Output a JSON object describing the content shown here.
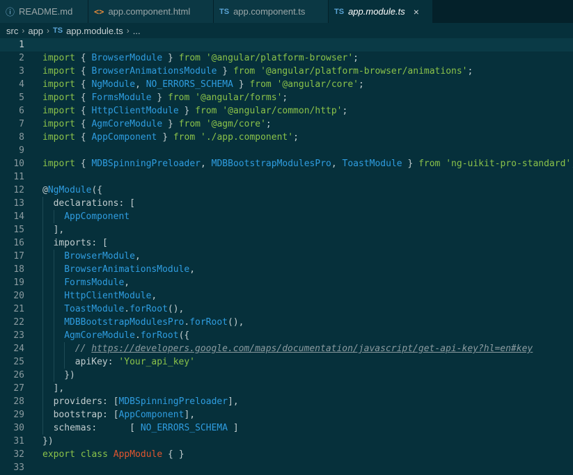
{
  "tabs": [
    {
      "icon": "info-icon",
      "glyph": "ⓘ",
      "label": "README.md"
    },
    {
      "icon": "html-file-icon",
      "glyph": "<>",
      "label": "app.component.html"
    },
    {
      "icon": "ts-file-icon",
      "glyph": "TS",
      "label": "app.component.ts"
    },
    {
      "icon": "ts-file-icon",
      "glyph": "TS",
      "label": "app.module.ts",
      "active": true,
      "close": "×"
    }
  ],
  "breadcrumb": {
    "parts": [
      "src",
      "app"
    ],
    "file_icon_glyph": "TS",
    "file": "app.module.ts",
    "ellipsis": "..."
  },
  "editor": {
    "current_line": 1,
    "lines": [
      {
        "n": "1",
        "indent": 0,
        "tokens": []
      },
      {
        "n": "2",
        "indent": 0,
        "tokens": [
          [
            "kw",
            "import"
          ],
          [
            "pun",
            " { "
          ],
          [
            "cls",
            "BrowserModule"
          ],
          [
            "pun",
            " } "
          ],
          [
            "kw",
            "from"
          ],
          [
            "pun",
            " "
          ],
          [
            "str",
            "'@angular/platform-browser'"
          ],
          [
            "pun",
            ";"
          ]
        ]
      },
      {
        "n": "3",
        "indent": 0,
        "tokens": [
          [
            "kw",
            "import"
          ],
          [
            "pun",
            " { "
          ],
          [
            "cls",
            "BrowserAnimationsModule"
          ],
          [
            "pun",
            " } "
          ],
          [
            "kw",
            "from"
          ],
          [
            "pun",
            " "
          ],
          [
            "str",
            "'@angular/platform-browser/animations'"
          ],
          [
            "pun",
            ";"
          ]
        ]
      },
      {
        "n": "4",
        "indent": 0,
        "tokens": [
          [
            "kw",
            "import"
          ],
          [
            "pun",
            " { "
          ],
          [
            "cls",
            "NgModule"
          ],
          [
            "pun",
            ", "
          ],
          [
            "cls",
            "NO_ERRORS_SCHEMA"
          ],
          [
            "pun",
            " } "
          ],
          [
            "kw",
            "from"
          ],
          [
            "pun",
            " "
          ],
          [
            "str",
            "'@angular/core'"
          ],
          [
            "pun",
            ";"
          ]
        ]
      },
      {
        "n": "5",
        "indent": 0,
        "tokens": [
          [
            "kw",
            "import"
          ],
          [
            "pun",
            " { "
          ],
          [
            "cls",
            "FormsModule"
          ],
          [
            "pun",
            " } "
          ],
          [
            "kw",
            "from"
          ],
          [
            "pun",
            " "
          ],
          [
            "str",
            "'@angular/forms'"
          ],
          [
            "pun",
            ";"
          ]
        ]
      },
      {
        "n": "6",
        "indent": 0,
        "tokens": [
          [
            "kw",
            "import"
          ],
          [
            "pun",
            " { "
          ],
          [
            "cls",
            "HttpClientModule"
          ],
          [
            "pun",
            " } "
          ],
          [
            "kw",
            "from"
          ],
          [
            "pun",
            " "
          ],
          [
            "str",
            "'@angular/common/http'"
          ],
          [
            "pun",
            ";"
          ]
        ]
      },
      {
        "n": "7",
        "indent": 0,
        "tokens": [
          [
            "kw",
            "import"
          ],
          [
            "pun",
            " { "
          ],
          [
            "cls",
            "AgmCoreModule"
          ],
          [
            "pun",
            " } "
          ],
          [
            "kw",
            "from"
          ],
          [
            "pun",
            " "
          ],
          [
            "str",
            "'@agm/core'"
          ],
          [
            "pun",
            ";"
          ]
        ]
      },
      {
        "n": "8",
        "indent": 0,
        "tokens": [
          [
            "kw",
            "import"
          ],
          [
            "pun",
            " { "
          ],
          [
            "cls",
            "AppComponent"
          ],
          [
            "pun",
            " } "
          ],
          [
            "kw",
            "from"
          ],
          [
            "pun",
            " "
          ],
          [
            "str",
            "'./app.component'"
          ],
          [
            "pun",
            ";"
          ]
        ]
      },
      {
        "n": "9",
        "indent": 0,
        "tokens": []
      },
      {
        "n": "10",
        "indent": 0,
        "tokens": [
          [
            "kw",
            "import"
          ],
          [
            "pun",
            " { "
          ],
          [
            "cls",
            "MDBSpinningPreloader"
          ],
          [
            "pun",
            ", "
          ],
          [
            "cls",
            "MDBBootstrapModulesPro"
          ],
          [
            "pun",
            ", "
          ],
          [
            "cls",
            "ToastModule"
          ],
          [
            "pun",
            " } "
          ],
          [
            "kw",
            "from"
          ],
          [
            "pun",
            " "
          ],
          [
            "str",
            "'ng-uikit-pro-standard'"
          ],
          [
            "pun",
            ";"
          ]
        ]
      },
      {
        "n": "11",
        "indent": 0,
        "tokens": []
      },
      {
        "n": "12",
        "indent": 0,
        "tokens": [
          [
            "at",
            "@"
          ],
          [
            "dec",
            "NgModule"
          ],
          [
            "pun",
            "({"
          ]
        ]
      },
      {
        "n": "13",
        "indent": 1,
        "tokens": [
          [
            "prop",
            "declarations"
          ],
          [
            "pun",
            ": ["
          ]
        ]
      },
      {
        "n": "14",
        "indent": 2,
        "tokens": [
          [
            "cls",
            "AppComponent"
          ]
        ]
      },
      {
        "n": "15",
        "indent": 1,
        "tokens": [
          [
            "pun",
            "],"
          ]
        ]
      },
      {
        "n": "16",
        "indent": 1,
        "tokens": [
          [
            "prop",
            "imports"
          ],
          [
            "pun",
            ": ["
          ]
        ]
      },
      {
        "n": "17",
        "indent": 2,
        "tokens": [
          [
            "cls",
            "BrowserModule"
          ],
          [
            "pun",
            ","
          ]
        ]
      },
      {
        "n": "18",
        "indent": 2,
        "tokens": [
          [
            "cls",
            "BrowserAnimationsModule"
          ],
          [
            "pun",
            ","
          ]
        ]
      },
      {
        "n": "19",
        "indent": 2,
        "tokens": [
          [
            "cls",
            "FormsModule"
          ],
          [
            "pun",
            ","
          ]
        ]
      },
      {
        "n": "20",
        "indent": 2,
        "tokens": [
          [
            "cls",
            "HttpClientModule"
          ],
          [
            "pun",
            ","
          ]
        ]
      },
      {
        "n": "21",
        "indent": 2,
        "tokens": [
          [
            "cls",
            "ToastModule"
          ],
          [
            "pun",
            "."
          ],
          [
            "fn",
            "forRoot"
          ],
          [
            "pun",
            "(),"
          ]
        ]
      },
      {
        "n": "22",
        "indent": 2,
        "tokens": [
          [
            "cls",
            "MDBBootstrapModulesPro"
          ],
          [
            "pun",
            "."
          ],
          [
            "fn",
            "forRoot"
          ],
          [
            "pun",
            "(),"
          ]
        ]
      },
      {
        "n": "23",
        "indent": 2,
        "tokens": [
          [
            "cls",
            "AgmCoreModule"
          ],
          [
            "pun",
            "."
          ],
          [
            "fn",
            "forRoot"
          ],
          [
            "pun",
            "({"
          ]
        ]
      },
      {
        "n": "24",
        "indent": 3,
        "tokens": [
          [
            "cmt",
            "// "
          ],
          [
            "cmt-link",
            "https://developers.google.com/maps/documentation/javascript/get-api-key?hl=en#key"
          ]
        ]
      },
      {
        "n": "25",
        "indent": 3,
        "tokens": [
          [
            "prop",
            "apiKey"
          ],
          [
            "pun",
            ": "
          ],
          [
            "str",
            "'Your_api_key'"
          ]
        ]
      },
      {
        "n": "26",
        "indent": 2,
        "tokens": [
          [
            "pun",
            "})"
          ]
        ]
      },
      {
        "n": "27",
        "indent": 1,
        "tokens": [
          [
            "pun",
            "],"
          ]
        ]
      },
      {
        "n": "28",
        "indent": 1,
        "tokens": [
          [
            "prop",
            "providers"
          ],
          [
            "pun",
            ": ["
          ],
          [
            "cls",
            "MDBSpinningPreloader"
          ],
          [
            "pun",
            "],"
          ]
        ]
      },
      {
        "n": "29",
        "indent": 1,
        "tokens": [
          [
            "prop",
            "bootstrap"
          ],
          [
            "pun",
            ": ["
          ],
          [
            "cls",
            "AppComponent"
          ],
          [
            "pun",
            "],"
          ]
        ]
      },
      {
        "n": "30",
        "indent": 1,
        "tokens": [
          [
            "prop",
            "schemas"
          ],
          [
            "pun",
            ":      [ "
          ],
          [
            "cls",
            "NO_ERRORS_SCHEMA"
          ],
          [
            "pun",
            " ]"
          ]
        ]
      },
      {
        "n": "31",
        "indent": 0,
        "tokens": [
          [
            "pun",
            "})"
          ]
        ]
      },
      {
        "n": "32",
        "indent": 0,
        "tokens": [
          [
            "kw",
            "export"
          ],
          [
            "pun",
            " "
          ],
          [
            "kw",
            "class"
          ],
          [
            "pun",
            " "
          ],
          [
            "orange",
            "AppModule"
          ],
          [
            "pun",
            " { }"
          ]
        ]
      },
      {
        "n": "33",
        "indent": 0,
        "tokens": []
      }
    ]
  },
  "colors": {
    "background": "#06303b",
    "tab_bar": "#04212a",
    "keyword": "#8ac24a",
    "identifier": "#2f9de0",
    "class_name": "#e0552f",
    "comment": "#8b9ba0"
  }
}
